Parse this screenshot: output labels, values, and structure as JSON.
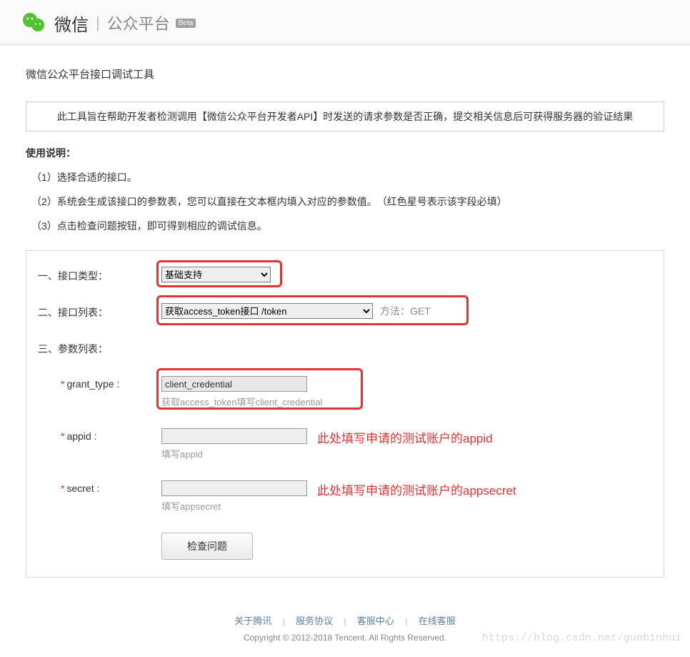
{
  "header": {
    "brand_wechat": "微信",
    "brand_platform": "公众平台",
    "beta": "Beta"
  },
  "page": {
    "title": "微信公众平台接口调试工具",
    "info_box": "此工具旨在帮助开发者检测调用【微信公众平台开发者API】时发送的请求参数是否正确，提交相关信息后可获得服务器的验证结果",
    "instructions_title": "使用说明：",
    "instructions": [
      "（1）选择合适的接口。",
      "（2）系统会生成该接口的参数表，您可以直接在文本框内填入对应的参数值。　（红色星号表示该字段必填）",
      "（3）点击检查问题按钮，即可得到相应的调试信息。"
    ]
  },
  "form": {
    "row1": {
      "label": "一、接口类型：",
      "select": "基础支持"
    },
    "row2": {
      "label": "二、接口列表：",
      "select": "获取access_token接口 /token",
      "method_label": "方法：",
      "method_value": "GET"
    },
    "row3": {
      "label": "三、参数列表："
    },
    "grant_type": {
      "label": "grant_type :",
      "value": "client_credential",
      "hint": "获取access_token填写client_credential"
    },
    "appid": {
      "label": "appid :",
      "value": "",
      "hint": "填写appid",
      "annotation": "此处填写申请的测试账户的appid"
    },
    "secret": {
      "label": "secret :",
      "value": "",
      "hint": "填写appsecret",
      "annotation": "此处填写申请的测试账户的appsecret"
    },
    "submit": "检查问题"
  },
  "footer": {
    "links": [
      "关于腾讯",
      "服务协议",
      "客服中心",
      "在线客服"
    ],
    "copyright": "Copyright © 2012-2018 Tencent. All Rights Reserved.",
    "watermark": "https://blog.csdn.net/guobinhui"
  }
}
